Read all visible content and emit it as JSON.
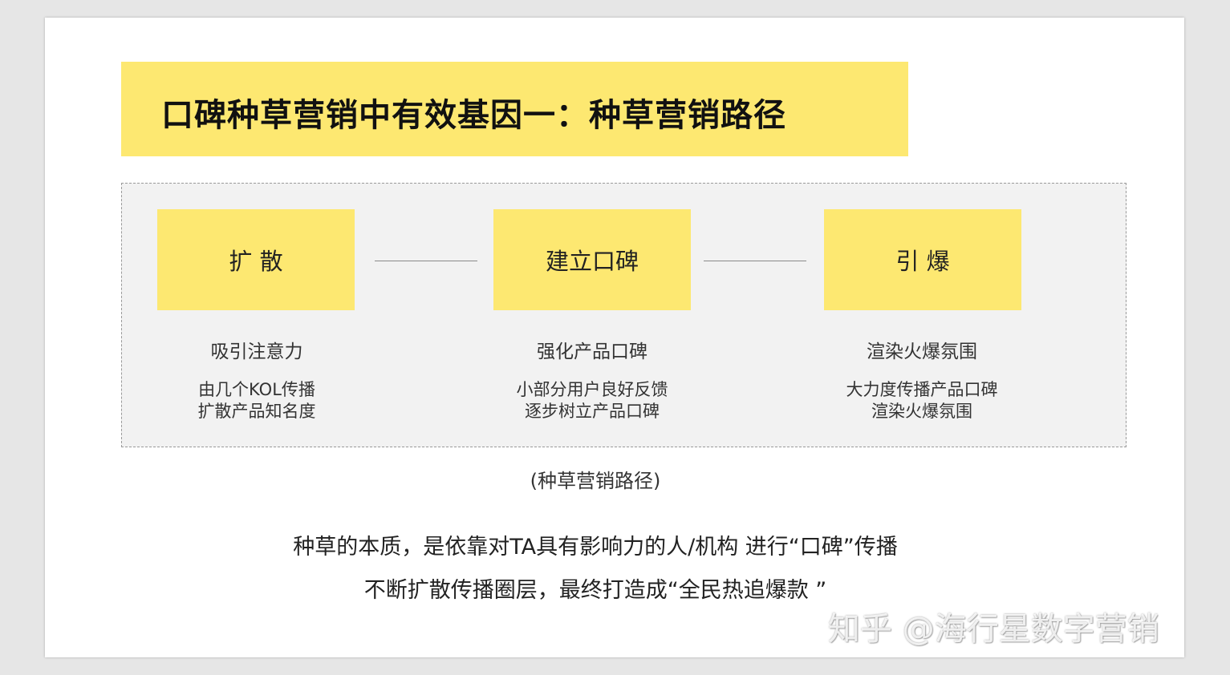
{
  "title": "口碑种草营销中有效基因一：种草营销路径",
  "stages": [
    {
      "label": "扩  散",
      "headline": "吸引注意力",
      "lines": [
        "由几个KOL传播",
        "扩散产品知名度"
      ]
    },
    {
      "label": "建立口碑",
      "headline": "强化产品口碑",
      "lines": [
        "小部分用户良好反馈",
        "逐步树立产品口碑"
      ]
    },
    {
      "label": "引  爆",
      "headline": "渲染火爆氛围",
      "lines": [
        "大力度传播产品口碑",
        "渲染火爆氛围"
      ]
    }
  ],
  "caption": "(种草营销路径)",
  "summary": [
    "种草的本质，是依靠对TA具有影响力的人/机构 进行“口碑”传播",
    "不断扩散传播圈层，最终打造成“全民热追爆款 ”"
  ],
  "watermark": "知乎 @海行星数字营销",
  "colors": {
    "accent_yellow": "#fde871",
    "panel_gray": "#f2f2f2"
  }
}
